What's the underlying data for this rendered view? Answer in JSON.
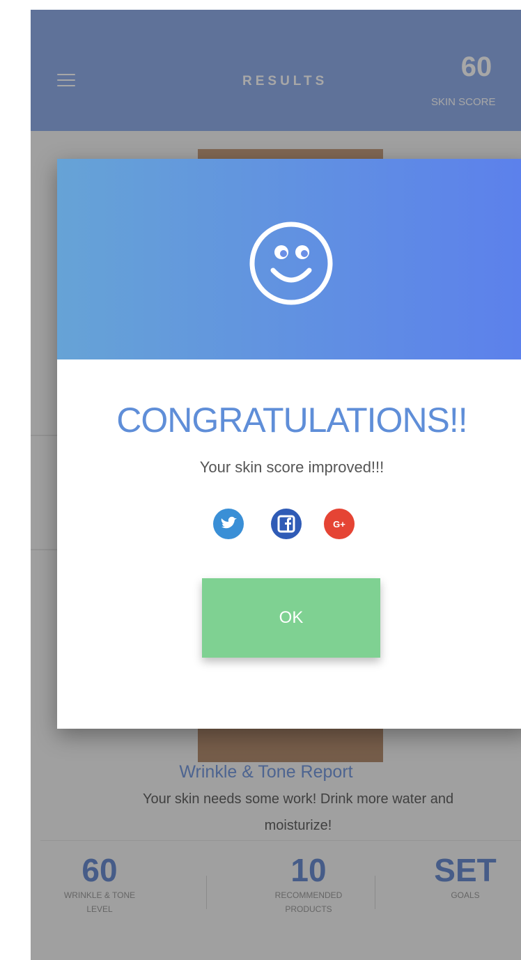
{
  "header": {
    "title": "RESULTS",
    "score_value": "60",
    "score_label": "SKIN SCORE"
  },
  "report": {
    "title": "Wrinkle & Tone Report",
    "description": "Your skin needs some work! Drink more water and moisturize!"
  },
  "stats": [
    {
      "value": "60",
      "label": "WRINKLE & TONE LEVEL"
    },
    {
      "value": "10",
      "label": "RECOMMENDED PRODUCTS"
    },
    {
      "value": "SET",
      "label": "GOALS"
    }
  ],
  "modal": {
    "heading": "CONGRATULATIONS!!",
    "message": "Your skin score improved!!!",
    "social": [
      "twitter-icon",
      "facebook-icon",
      "google-plus-icon"
    ],
    "google_plus_glyph": "G+",
    "ok_label": "OK"
  },
  "colors": {
    "header_bg": "#7d9fe6",
    "modal_gradient_start": "#66a3d6",
    "modal_gradient_end": "#5c80ec",
    "heading": "#5f8ed8",
    "ok_button": "#7fd192",
    "twitter": "#3a8fd6",
    "facebook": "#2f5bb6",
    "google_plus": "#e54434"
  }
}
